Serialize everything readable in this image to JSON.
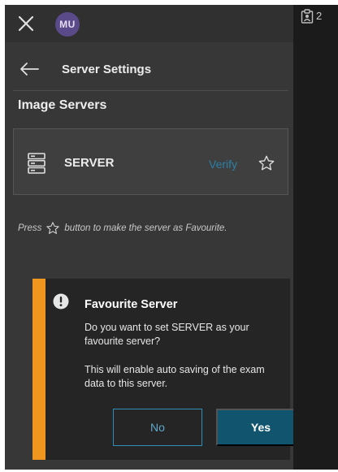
{
  "topbar": {
    "close_icon": "close-icon",
    "avatar_initials": "MU",
    "avatar_color": "#5b4a8a"
  },
  "header": {
    "back_icon": "arrow-left-icon",
    "title": "Server Settings"
  },
  "section": {
    "title": "Image Servers"
  },
  "server": {
    "icon": "server-icon",
    "name": "SERVER",
    "verify_label": "Verify",
    "favourite_icon": "star-outline-icon"
  },
  "hint": {
    "before": "Press",
    "after": "button to make the server as Favourite."
  },
  "dialog": {
    "icon": "info-icon",
    "accent_color": "#f0961f",
    "title": "Favourite Server",
    "message1": "Do you want to set SERVER as your favourite server?",
    "message2": "This will enable auto saving of the exam data to this server.",
    "no_label": "No",
    "yes_label": "Yes"
  },
  "side": {
    "icon": "clipboard-icon",
    "count": "2"
  },
  "colors": {
    "panel": "#373737",
    "link": "#2c7fa6",
    "primary": "#11546e"
  }
}
